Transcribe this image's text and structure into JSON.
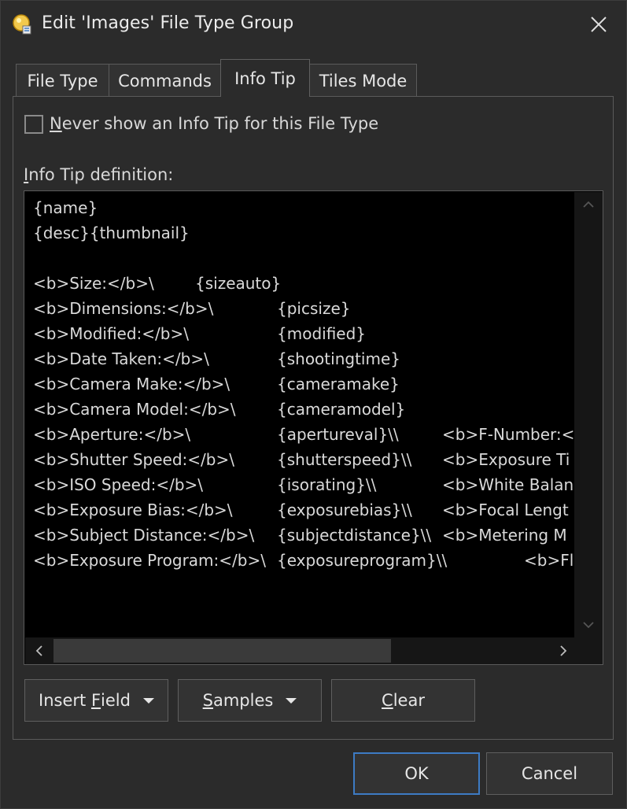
{
  "window": {
    "title": "Edit 'Images' File Type Group"
  },
  "tabs": [
    {
      "label": "File Type"
    },
    {
      "label": "Commands"
    },
    {
      "label": "Info Tip"
    },
    {
      "label": "Tiles Mode"
    }
  ],
  "active_tab": "Info Tip",
  "never_show": {
    "checked": false,
    "mnemonic": "N",
    "label_rest": "ever show an Info Tip for this File Type"
  },
  "definition": {
    "mnemonic": "I",
    "label_rest": "nfo Tip definition:"
  },
  "editor_lines": [
    {
      "parts": [
        "{name}"
      ]
    },
    {
      "parts": [
        "{desc}{thumbnail}"
      ]
    },
    {
      "parts": [
        ""
      ]
    },
    {
      "parts": [
        "<b>Size:</b>\\",
        "{sizeauto}"
      ]
    },
    {
      "parts": [
        "<b>Dimensions:</b>\\",
        "{picsize}"
      ]
    },
    {
      "parts": [
        "<b>Modified:</b>\\",
        "{modified}"
      ]
    },
    {
      "parts": [
        "<b>Date Taken:</b>\\",
        "{shootingtime}"
      ]
    },
    {
      "parts": [
        "<b>Camera Make:</b>\\",
        "{cameramake}"
      ]
    },
    {
      "parts": [
        "<b>Camera Model:</b>\\",
        "{cameramodel}"
      ]
    },
    {
      "parts": [
        "<b>Aperture:</b>\\",
        "{apertureval}\\\\",
        "<b>F-Number:<"
      ]
    },
    {
      "parts": [
        "<b>Shutter Speed:</b>\\",
        "{shutterspeed}\\\\",
        "<b>Exposure Ti"
      ]
    },
    {
      "parts": [
        "<b>ISO Speed:</b>\\",
        "{isorating}\\\\",
        "<b>White Balan"
      ]
    },
    {
      "parts": [
        "<b>Exposure Bias:</b>\\",
        "{exposurebias}\\\\",
        "<b>Focal Lengt"
      ]
    },
    {
      "parts": [
        "<b>Subject Distance:</b>\\",
        "{subjectdistance}\\\\",
        "<b>Metering M"
      ]
    },
    {
      "parts": [
        "<b>Exposure Program:</b>\\",
        "{exposureprogram}\\\\",
        "<b>Fl"
      ]
    }
  ],
  "buttons": {
    "insert_field": {
      "pre": "Insert ",
      "mnemonic": "F",
      "post": "ield"
    },
    "samples": {
      "pre": "",
      "mnemonic": "S",
      "post": "amples"
    },
    "clear": {
      "pre": "",
      "mnemonic": "C",
      "post": "lear"
    },
    "ok": "OK",
    "cancel": "Cancel"
  },
  "icons": {
    "app": "file-type-group-icon",
    "close": "close-icon",
    "scroll_up": "chevron-up-icon",
    "scroll_down": "chevron-down-icon",
    "scroll_left": "chevron-left-icon",
    "scroll_right": "chevron-right-icon",
    "dropdown": "caret-down-icon"
  },
  "colors": {
    "background": "#2b2b2b",
    "editor_background": "#000000",
    "default_button_border": "#3d7bc4",
    "text": "#e6e6e6"
  }
}
